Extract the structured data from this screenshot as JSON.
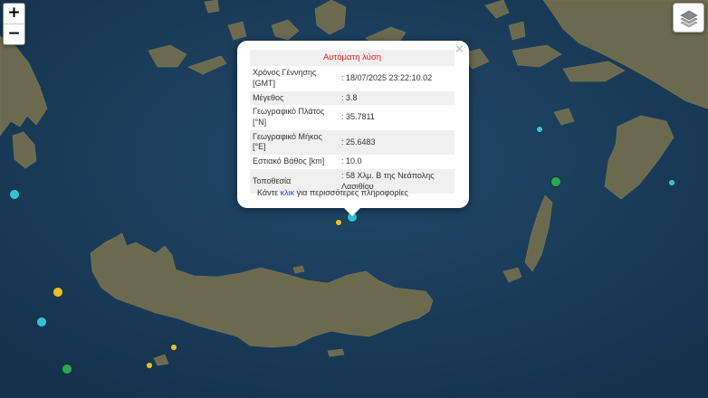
{
  "map": {
    "zoom_in_label": "+",
    "zoom_out_label": "−",
    "layers_icon": "layers-icon",
    "sea_color": "#1b3a55",
    "land_color": "#6b6a4e"
  },
  "popup": {
    "title": "Αυτόματη λύση",
    "close_label": "×",
    "rows": [
      {
        "label": "Χρόνος Γέννησης [GMT]",
        "value": ": 18/07/2025 23:22:10.02"
      },
      {
        "label": "Μέγεθος",
        "value": ": 3.8"
      },
      {
        "label": "Γεωγραφικό Πλάτος [°N]",
        "value": ": 35.7811"
      },
      {
        "label": "Γεωγραφικό Μήκος [°E]",
        "value": ": 25.6483"
      },
      {
        "label": "Εστιακό Βάθος [km]",
        "value": ": 10.0"
      },
      {
        "label": "Τοποθεσία",
        "value": ": 58 Χλμ. Β της Νεάπολης Λασιθίου"
      }
    ],
    "more_prefix": "Κάντε ",
    "more_link": "κλικ",
    "more_suffix": " για περισσότερες πληροφορίες"
  },
  "markers": [
    {
      "color": "#2ec4d6"
    },
    {
      "color": "#2ec4d6"
    },
    {
      "color": "#2ec4d6"
    },
    {
      "color": "#2ec4d6"
    },
    {
      "color": "#2ec4d6"
    },
    {
      "color": "#28a850"
    },
    {
      "color": "#28a850"
    },
    {
      "color": "#e0c030"
    },
    {
      "color": "#e0c030"
    },
    {
      "color": "#e0c030"
    },
    {
      "color": "#e0c030"
    }
  ]
}
